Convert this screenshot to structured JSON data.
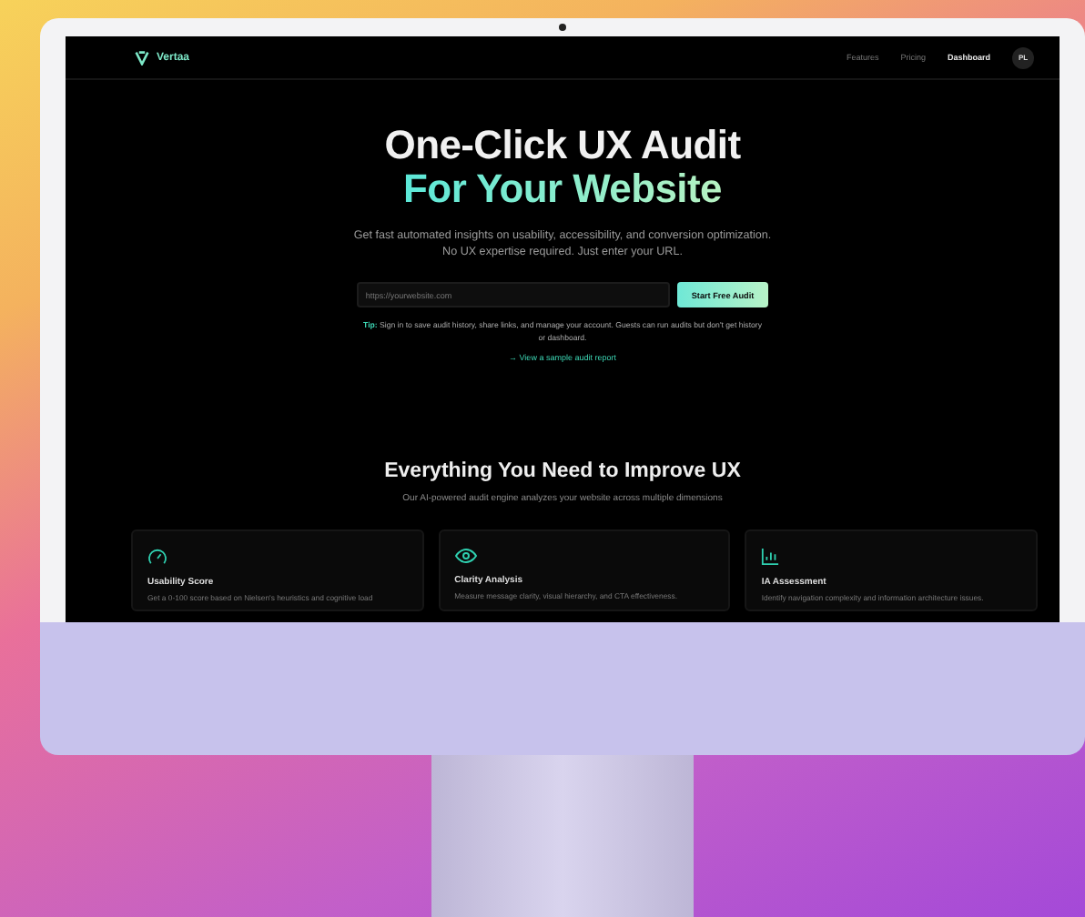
{
  "nav": {
    "logo": "Vertaa",
    "links": [
      {
        "label": "Features",
        "selected": false
      },
      {
        "label": "Pricing",
        "selected": false
      },
      {
        "label": "Dashboard",
        "selected": true
      }
    ],
    "avatar": "PL"
  },
  "hero": {
    "title_line_1": "One-Click UX Audit",
    "title_line_2": "For Your Website",
    "subtitle": "Get fast automated insights on usability, accessibility, and conversion optimization. No UX expertise required. Just enter your URL.",
    "url_field": {
      "placeholder": "https://yourwebsite.com"
    },
    "cta": "Start Free Audit",
    "tip": "**Tip:** Sign in to save audit history, share links, and manage your account. Guests can run audits but don't get history or dashboard.",
    "sample_link": "→ View a sample audit report"
  },
  "features": {
    "heading": "Everything You Need to Improve UX",
    "subheading": "Our AI-powered audit engine analyzes your website across multiple dimensions",
    "cards": [
      {
        "kind": "gauge",
        "title": "Usability Score",
        "description": "Get a 0-100 score based on Nielsen's heuristics and cognitive load"
      },
      {
        "kind": "eye",
        "title": "Clarity Analysis",
        "description": "Measure message clarity, visual hierarchy, and CTA effectiveness."
      },
      {
        "kind": "chart",
        "title": "IA Assessment",
        "description": "Identify navigation complexity and information architecture issues."
      }
    ]
  }
}
